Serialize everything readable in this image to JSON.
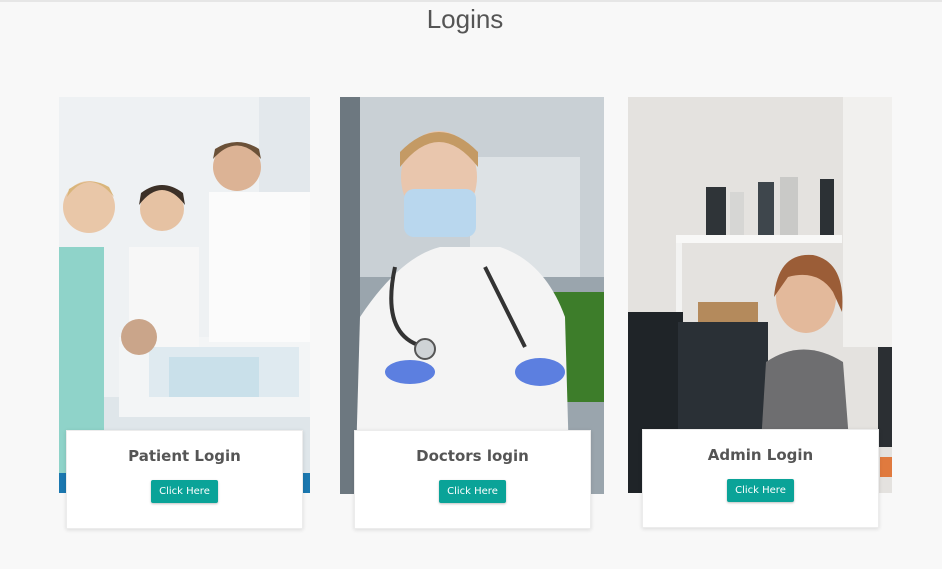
{
  "page": {
    "title": "Logins"
  },
  "cards": [
    {
      "title": "Patient Login",
      "button": "Click Here",
      "image": "patient-ward-photo"
    },
    {
      "title": "Doctors login",
      "button": "Click Here",
      "image": "doctor-portrait-photo"
    },
    {
      "title": "Admin Login",
      "button": "Click Here",
      "image": "admin-office-photo"
    }
  ],
  "colors": {
    "accent": "#0aa398",
    "background": "#f8f8f8",
    "title_text": "#555555"
  }
}
